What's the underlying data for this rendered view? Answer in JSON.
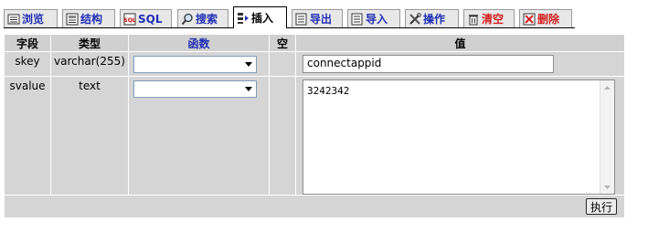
{
  "tabs": [
    {
      "label": "浏览",
      "icon": "browse-icon"
    },
    {
      "label": "结构",
      "icon": "structure-icon"
    },
    {
      "label": "SQL",
      "icon": "sql-icon"
    },
    {
      "label": "搜索",
      "icon": "search-icon"
    },
    {
      "label": "插入",
      "icon": "insert-icon",
      "active": true
    },
    {
      "label": "导出",
      "icon": "export-icon"
    },
    {
      "label": "导入",
      "icon": "import-icon"
    },
    {
      "label": "操作",
      "icon": "operations-icon"
    },
    {
      "label": "清空",
      "icon": "empty-icon"
    },
    {
      "label": "删除",
      "icon": "drop-icon"
    }
  ],
  "table": {
    "headers": {
      "field": "字段",
      "type": "类型",
      "function": "函数",
      "null": "空",
      "value": "值"
    },
    "rows": [
      {
        "field": "skey",
        "type": "varchar(255)",
        "function": "",
        "value": "connectappid"
      },
      {
        "field": "svalue",
        "type": "text",
        "function": "",
        "value": "3242342"
      }
    ]
  },
  "actions": {
    "execute_label": "执行"
  },
  "colors": {
    "link": "#1f2fb5",
    "danger": "#d21f1f",
    "cell_bg": "#d5d5d5",
    "header_bg": "#d0d0d0"
  }
}
